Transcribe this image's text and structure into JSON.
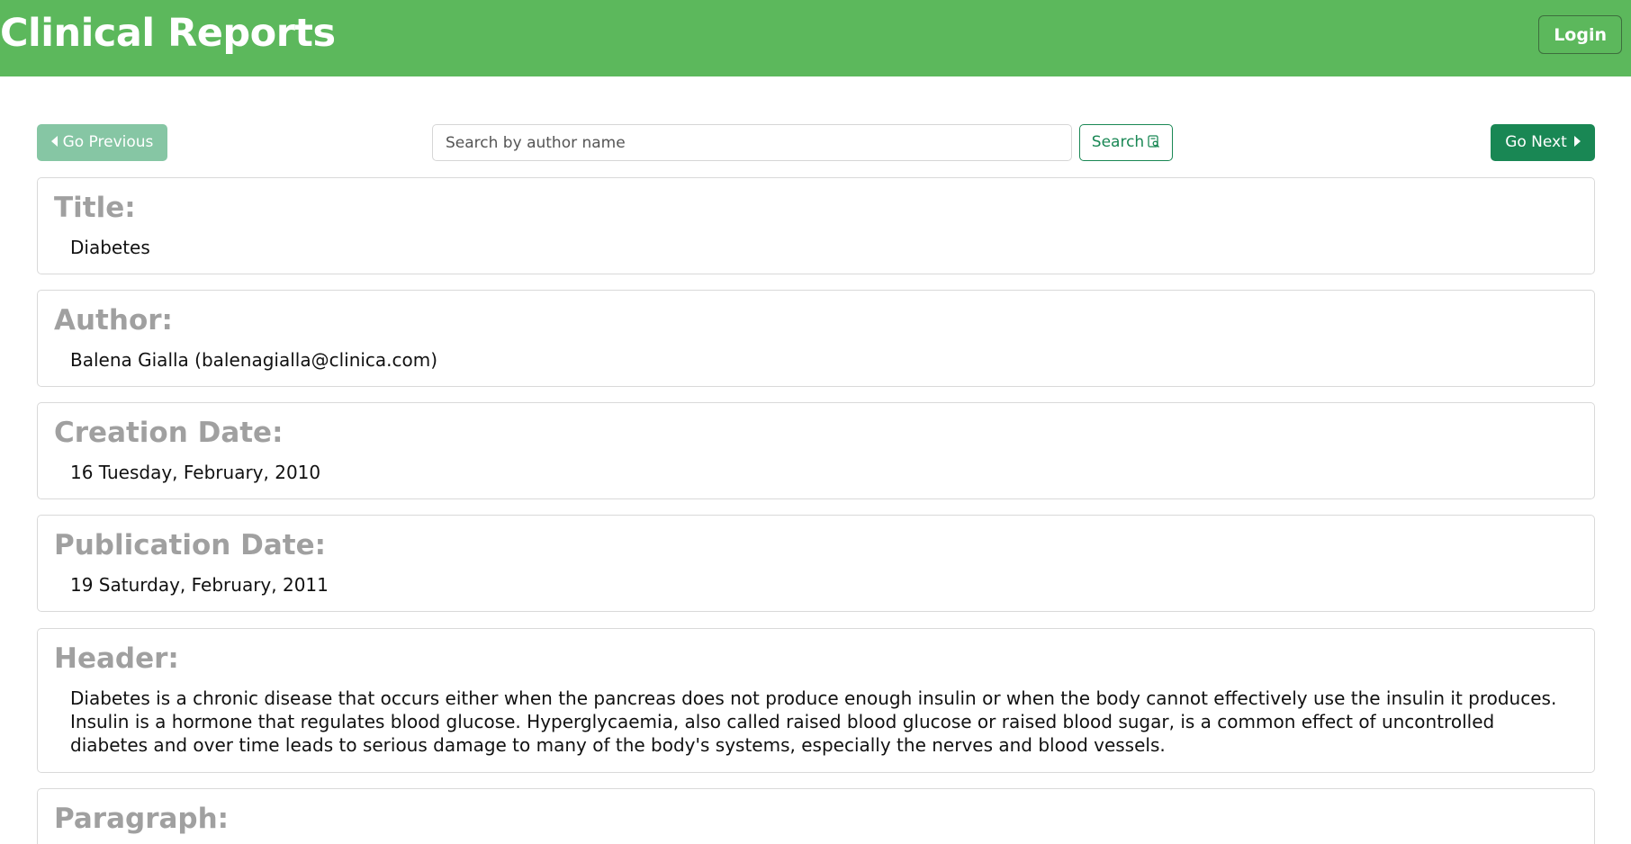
{
  "app": {
    "title": "Clinical Reports",
    "login_label": "Login"
  },
  "toolbar": {
    "prev_label": "Go Previous",
    "next_label": "Go Next",
    "search_placeholder": "Search by author name",
    "search_value": "",
    "search_label": "Search"
  },
  "report": {
    "title_label": "Title:",
    "title_value": "Diabetes",
    "author_label": "Author:",
    "author_value": "Balena Gialla (balenagialla@clinica.com)",
    "creation_label": "Creation Date:",
    "creation_value": "16 Tuesday, February, 2010",
    "publication_label": "Publication Date:",
    "publication_value": "19 Saturday, February, 2011",
    "header_label": "Header:",
    "header_value": "Diabetes is a chronic disease that occurs either when the pancreas does not produce enough insulin or when the body cannot effectively use the insulin it produces. Insulin is a hormone that regulates blood glucose. Hyperglycaemia, also called raised blood glucose or raised blood sugar, is a common effect of uncontrolled diabetes and over time leads to serious damage to many of the body's systems, especially the nerves and blood vessels.",
    "paragraph_label": "Paragraph:"
  },
  "colors": {
    "navbar": "#5cb85c",
    "primary": "#198754",
    "primary_disabled": "#86c6a4",
    "label_gray": "#a0a0a0"
  },
  "icons": {
    "prev": "caret-left-icon",
    "next": "caret-right-icon",
    "search": "search-document-icon"
  }
}
